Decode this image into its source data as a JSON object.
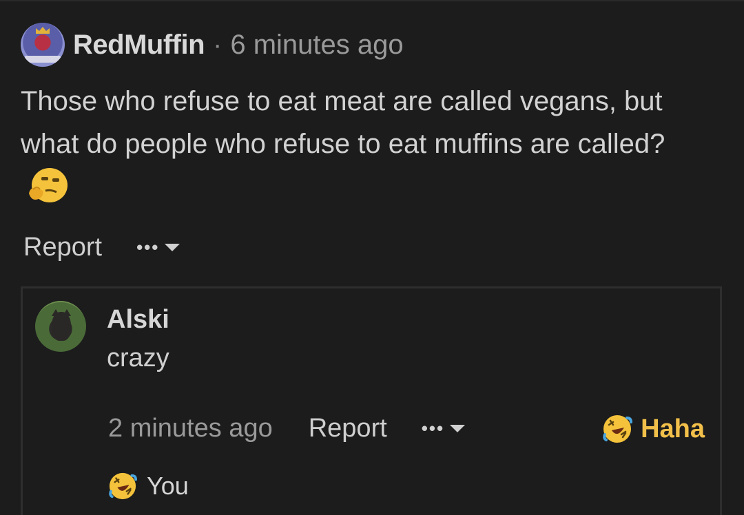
{
  "post": {
    "author": "RedMuffin",
    "separator": "·",
    "time": "6 minutes ago",
    "body": "Those who refuse to eat meat are called vegans, but what do people who refuse to eat muffins are called?",
    "emoji": "thinking-face",
    "actions": {
      "report_label": "Report",
      "more_label": "•••"
    }
  },
  "reply": {
    "author": "Alski",
    "text": "crazy",
    "time": "2 minutes ago",
    "report_label": "Report",
    "more_label": "•••",
    "reaction_button_label": "Haha",
    "reaction_button_color": "#f2c04a",
    "reactions": [
      {
        "emoji": "rolling-on-floor-laughing",
        "who": "You"
      }
    ]
  }
}
